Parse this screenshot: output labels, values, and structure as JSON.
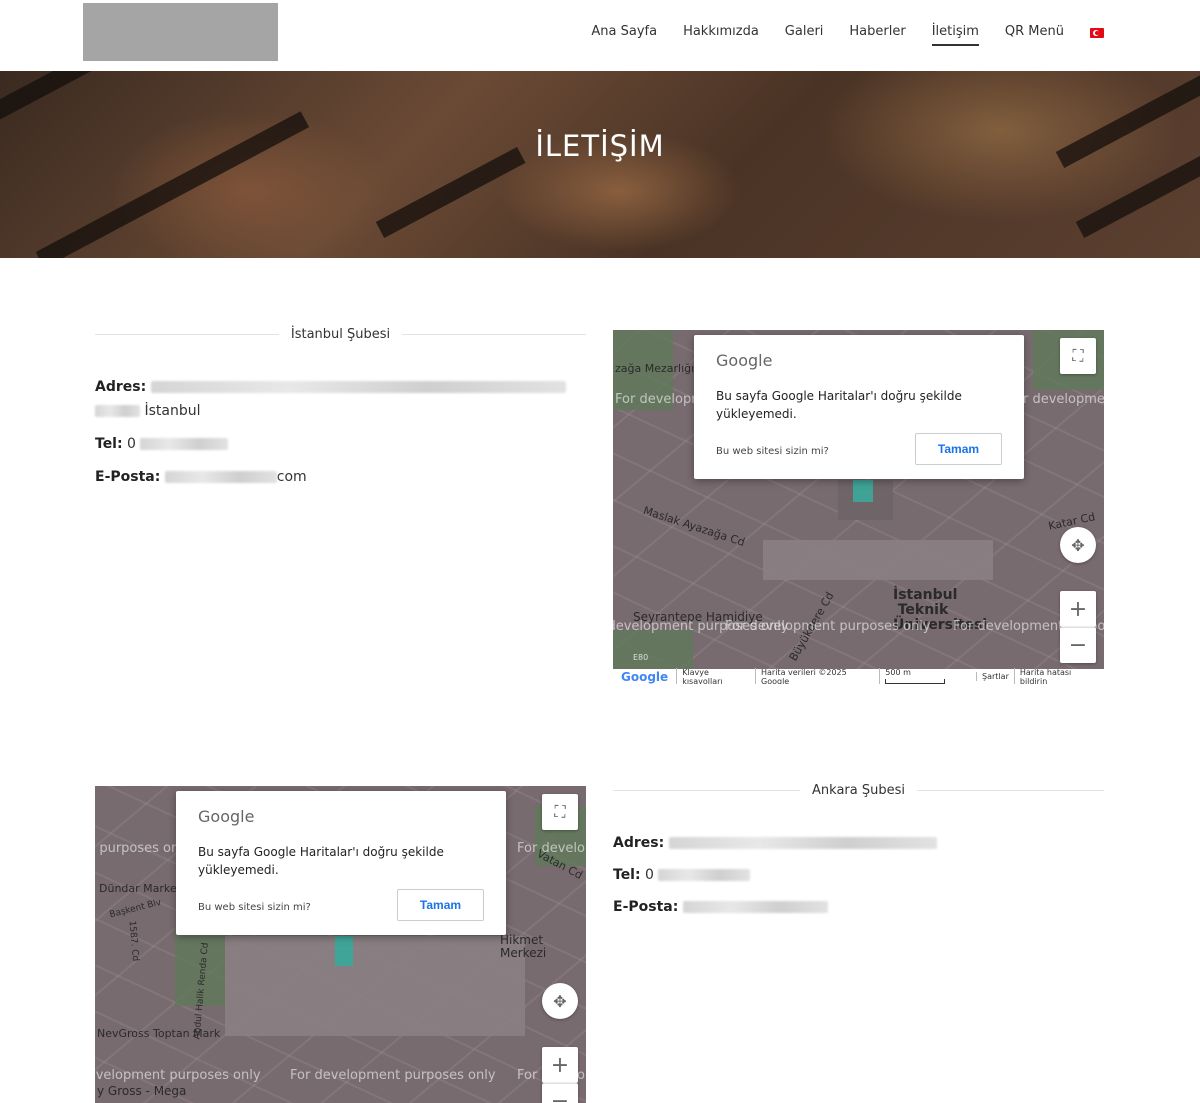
{
  "nav": {
    "items": [
      "Ana Sayfa",
      "Hakkımızda",
      "Galeri",
      "Haberler",
      "İletişim",
      "QR Menü"
    ],
    "active": "İletişim"
  },
  "hero": {
    "title": "İLETİŞİM"
  },
  "istanbul": {
    "heading": "İstanbul Şubesi",
    "adres_label": "Adres:",
    "adres_city": "İstanbul",
    "tel_label": "Tel:",
    "tel_prefix": "0",
    "eposta_label": "E-Posta:",
    "eposta_suffix": "com"
  },
  "ankara": {
    "heading": "Ankara Şubesi",
    "adres_label": "Adres:",
    "tel_label": "Tel:",
    "tel_prefix": "0",
    "eposta_label": "E-Posta:"
  },
  "map_dialog": {
    "brand": "Google",
    "message": "Bu sayfa Google Haritalar'ı doğru şekilde yükleyemedi.",
    "owner_question": "Bu web sitesi sizin mi?",
    "ok_label": "Tamam"
  },
  "map1": {
    "watermark": "For development purposes only",
    "labels": [
      "İstanbul Teknik Üniversitesi",
      "Maslak Ayazağa Cd",
      "Seyrantepe Hamidiye",
      "Katar Cd",
      "Büyükdere Cd",
      "zağa Mezarlığı",
      "E80"
    ],
    "footer": [
      "Klavye kısayolları",
      "Harita verileri ©2025 Google",
      "500 m",
      "Şartlar",
      "Harita hatası bildirin"
    ]
  },
  "map2": {
    "watermark": "For development purposes only",
    "labels": [
      "Dündar Market",
      "Başkent Blv",
      "Hikmet Merkezi",
      "NevGross Toptan Mark",
      "Vatan Cd",
      "y Gross - Mega",
      "Abdul Halik Renda Cd",
      "1587. Cd"
    ]
  },
  "colors": {
    "map_tint": "#786b70",
    "button_blue": "#1a73e8",
    "flag_red": "#e30a17"
  }
}
